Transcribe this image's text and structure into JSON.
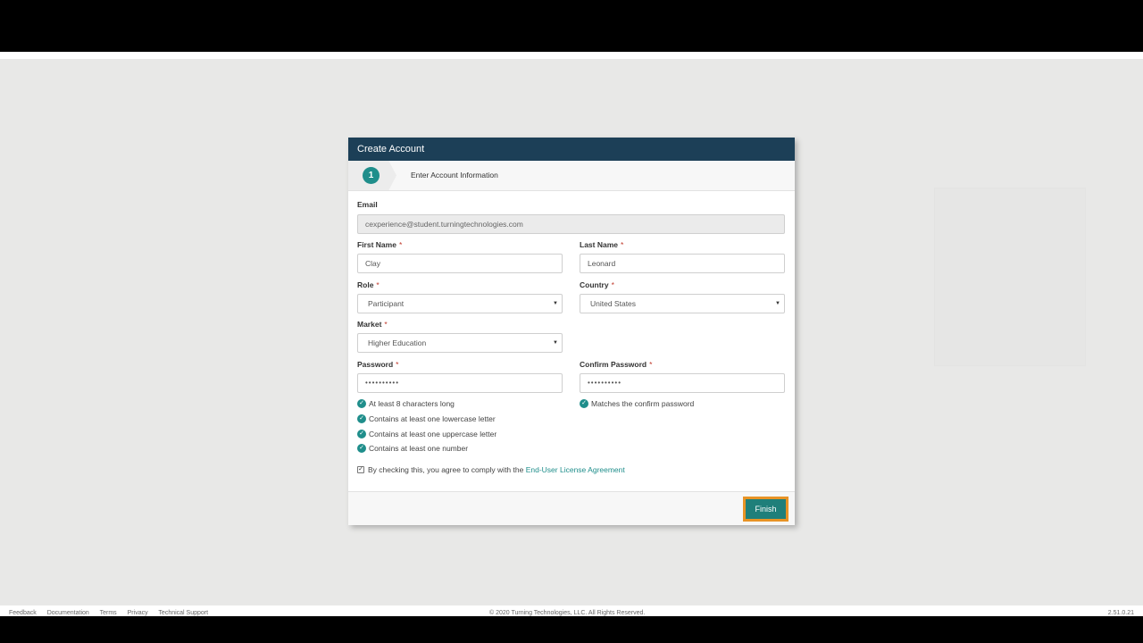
{
  "card": {
    "title": "Create Account",
    "step_number": "1",
    "step_label": "Enter Account Information"
  },
  "form": {
    "email": {
      "label": "Email",
      "value": "cexperience@student.turningtechnologies.com"
    },
    "first_name": {
      "label": "First Name",
      "value": "Clay"
    },
    "last_name": {
      "label": "Last Name",
      "value": "Leonard"
    },
    "role": {
      "label": "Role",
      "value": "Participant"
    },
    "country": {
      "label": "Country",
      "value": "United States"
    },
    "market": {
      "label": "Market",
      "value": "Higher Education"
    },
    "password": {
      "label": "Password",
      "value": "••••••••••"
    },
    "confirm_password": {
      "label": "Confirm Password",
      "value": "••••••••••"
    },
    "required_mark": "*"
  },
  "password_rules": [
    "At least 8 characters long",
    "Contains at least one lowercase letter",
    "Contains at least one uppercase letter",
    "Contains at least one number"
  ],
  "confirm_rule": "Matches the confirm password",
  "agreement": {
    "text": "By checking this, you agree to comply with the",
    "link": "End-User License Agreement",
    "checked": true
  },
  "finish_label": "Finish",
  "footer": {
    "links": [
      "Feedback",
      "Documentation",
      "Terms",
      "Privacy",
      "Technical Support"
    ],
    "copyright": "© 2020 Turning Technologies, LLC. All Rights Reserved.",
    "version": "2.51.0.21"
  },
  "colors": {
    "header": "#1c3f57",
    "accent": "#1f8e8b",
    "finish_button": "#1f7f7a",
    "focus_outline": "#e89325",
    "page_background": "#e8e8e7"
  },
  "icons": [
    "check-circle-icon",
    "checkbox-icon",
    "caret-down-icon"
  ]
}
